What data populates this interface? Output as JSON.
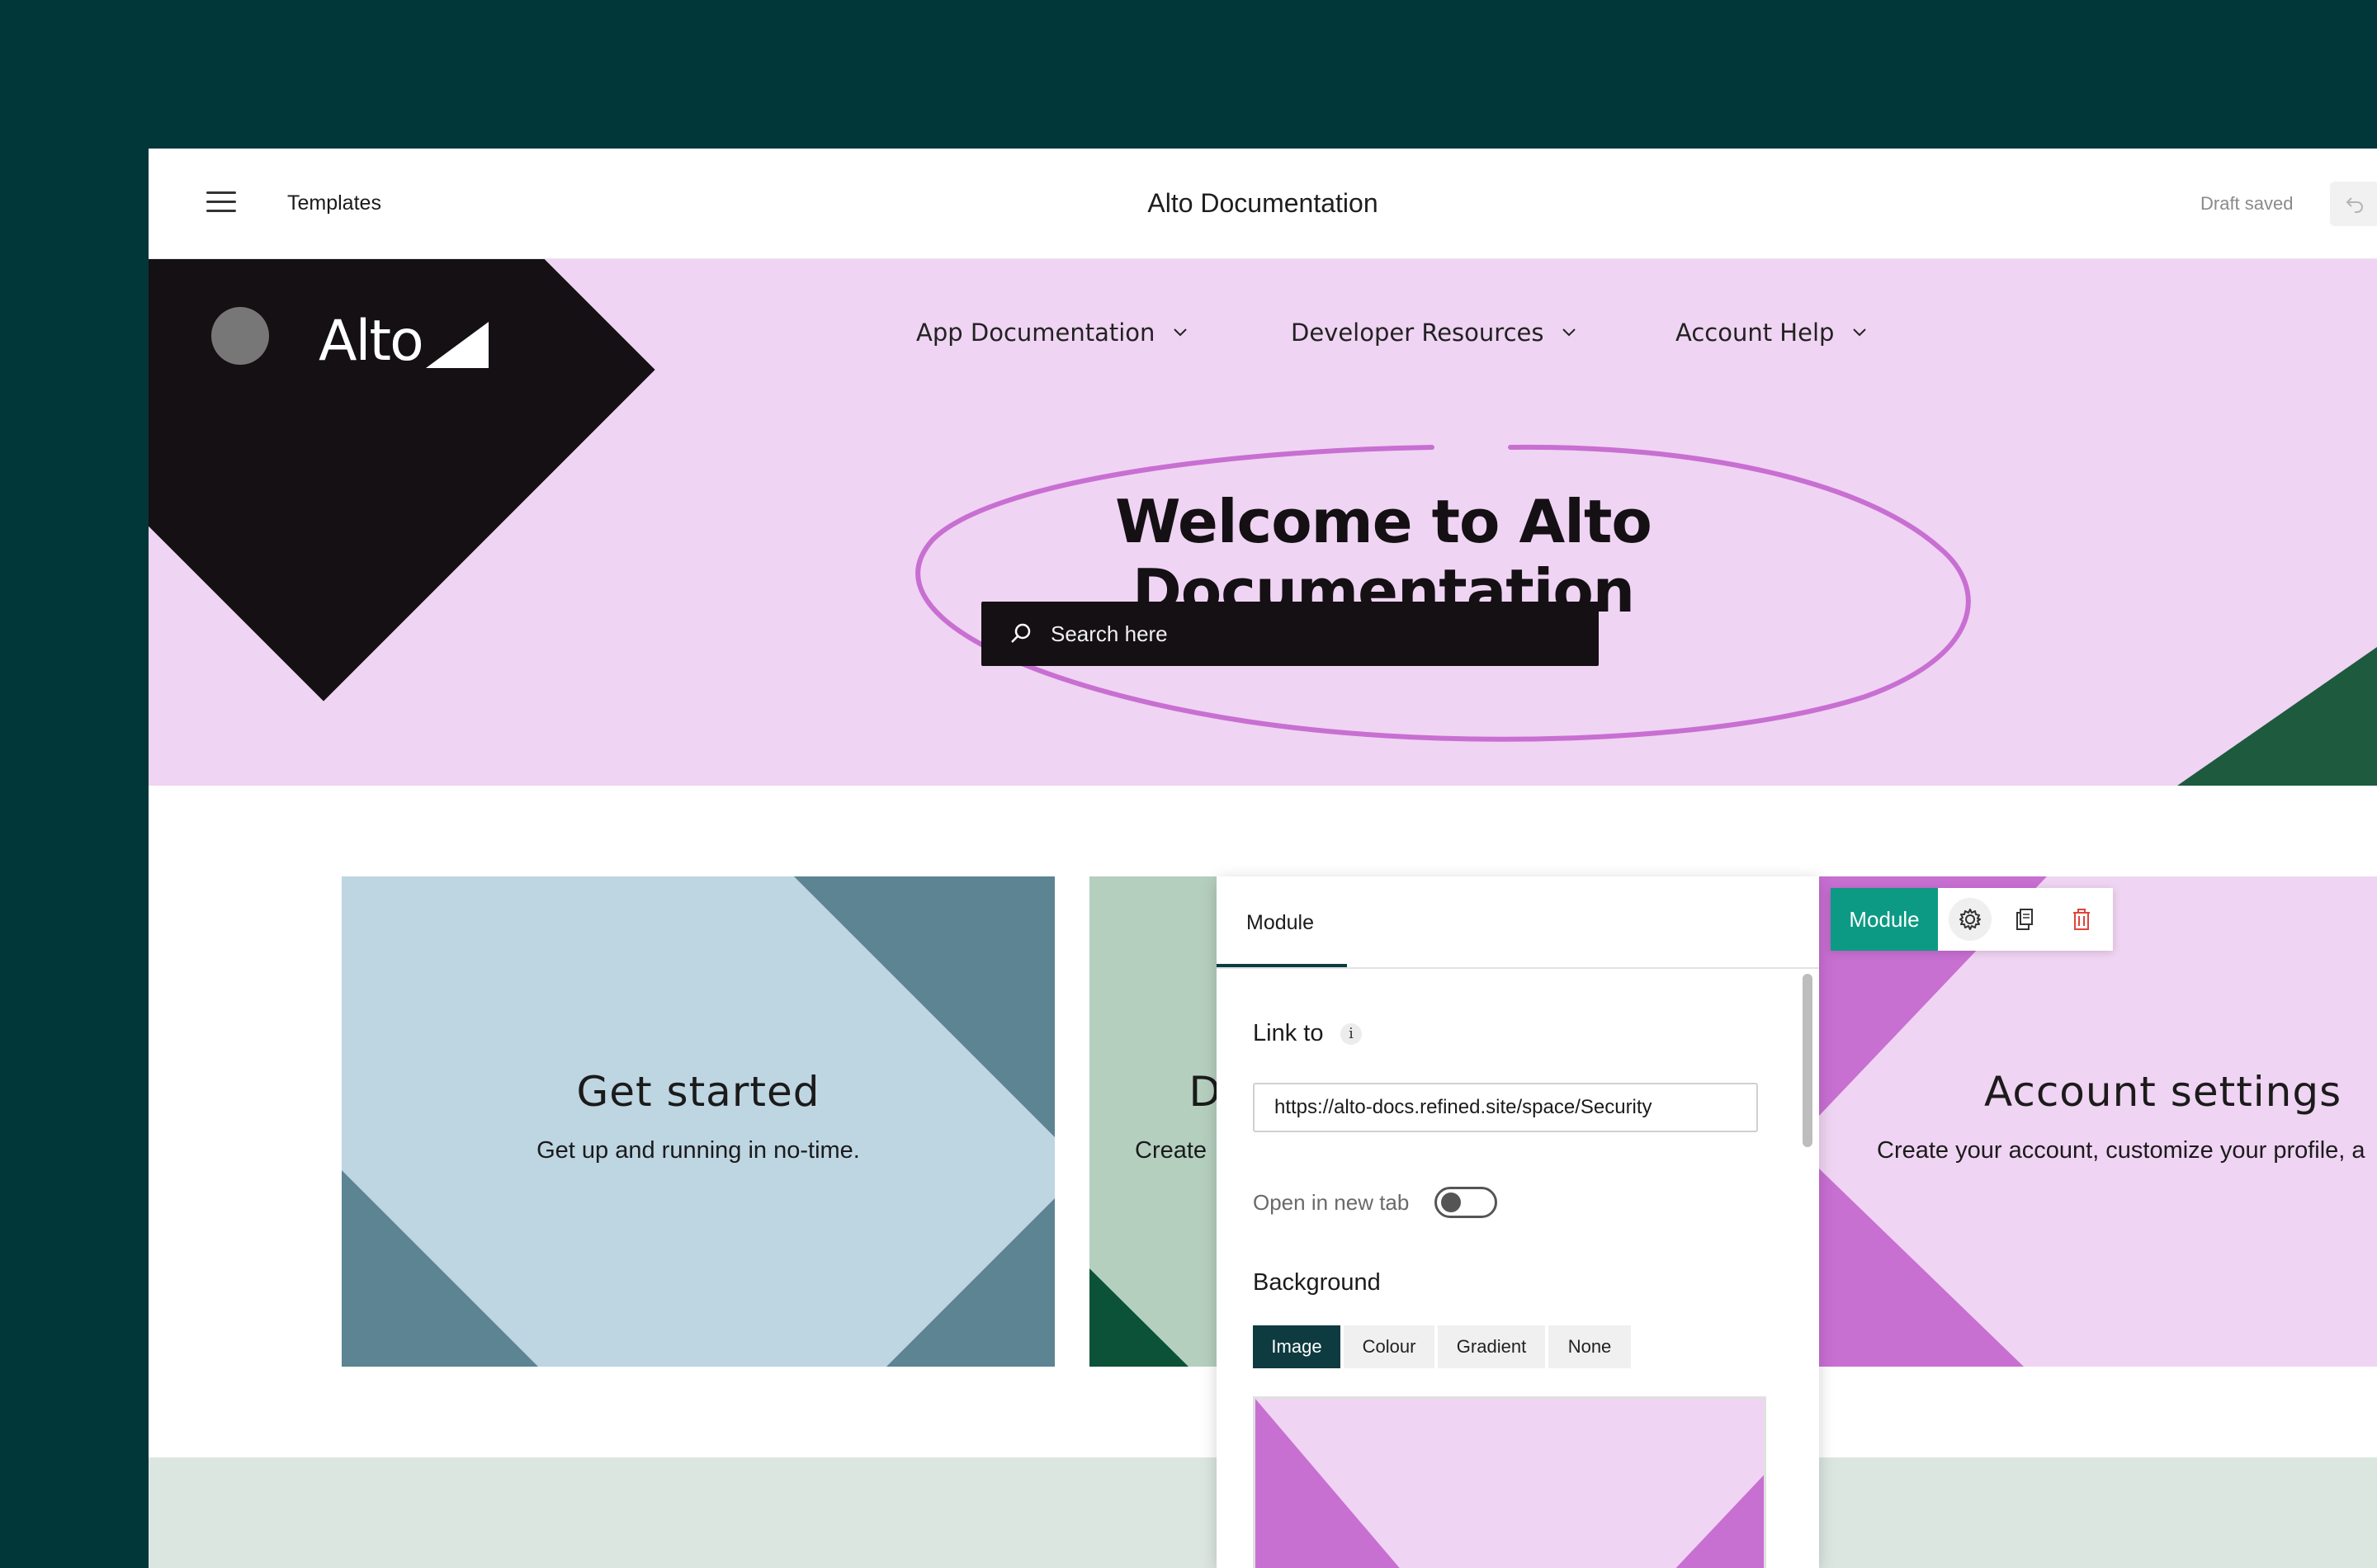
{
  "topbar": {
    "templates_label": "Templates",
    "title": "Alto Documentation",
    "status": "Draft saved"
  },
  "hero": {
    "logo_text": "Alto",
    "nav": [
      {
        "label": "App Documentation"
      },
      {
        "label": "Developer Resources"
      },
      {
        "label": "Account Help"
      }
    ],
    "title": "Welcome to Alto Documentation",
    "search_placeholder": "Search here"
  },
  "cards": [
    {
      "title": "Get started",
      "subtitle": "Get up and running in no-time."
    },
    {
      "title": "D",
      "subtitle": "Create"
    },
    {
      "title": "Account settings",
      "subtitle": "Create your account, customize your profile, a"
    }
  ],
  "panel": {
    "tab": "Module",
    "link_label": "Link to",
    "info": "i",
    "url": "https://alto-docs.refined.site/space/Security",
    "new_tab_label": "Open in new tab",
    "new_tab_enabled": false,
    "background_label": "Background",
    "background_options": [
      "Image",
      "Colour",
      "Gradient",
      "None"
    ],
    "background_selected": "Image"
  },
  "toolbar": {
    "module_label": "Module"
  },
  "colors": {
    "page_bg": "#02373A",
    "hero_bg": "#F0D4F3",
    "accent_teal": "#0C9A84",
    "dark": "#141014"
  }
}
